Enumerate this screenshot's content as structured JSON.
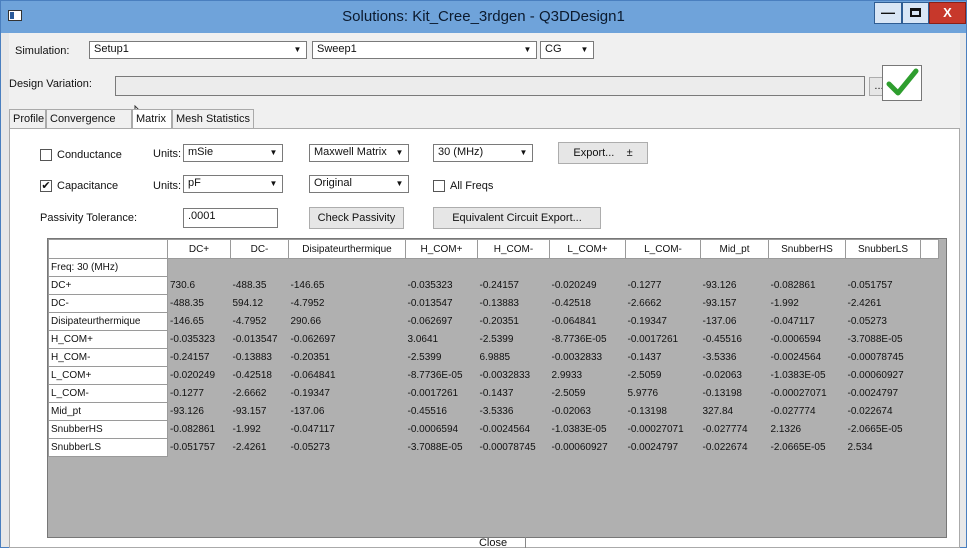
{
  "window": {
    "title": "Solutions: Kit_Cree_3rdgen - Q3DDesign1",
    "min_glyph": "—",
    "close_glyph": "X"
  },
  "simulation": {
    "label": "Simulation:",
    "setup": "Setup1",
    "sweep": "Sweep1",
    "type": "CG"
  },
  "design_variation": {
    "label": "Design Variation:",
    "value": "",
    "browse_label": "..."
  },
  "tabs": [
    "Profile",
    "Convergence",
    "Matrix",
    "Mesh Statistics"
  ],
  "matrix": {
    "conductance": {
      "label": "Conductance",
      "checked": false,
      "units_label": "Units:",
      "units": "mSie"
    },
    "capacitance": {
      "label": "Capacitance",
      "checked": true,
      "units_label": "Units:",
      "units": "pF"
    },
    "matrix_type": "Maxwell Matrix",
    "matrix_variant": "Original",
    "frequency": "30 (MHz)",
    "export_label": "Export...",
    "export_icon": "download-icon",
    "all_freqs_label": "All Freqs",
    "passivity_label": "Passivity Tolerance:",
    "passivity_value": ".0001",
    "check_passivity_label": "Check Passivity",
    "equiv_circuit_label": "Equivalent Circuit Export..."
  },
  "table": {
    "columns": [
      "DC+",
      "DC-",
      "Disipateurthermique",
      "H_COM+",
      "H_COM-",
      "L_COM+",
      "L_COM-",
      "Mid_pt",
      "SnubberHS",
      "SnubberLS"
    ],
    "freq_row": "Freq: 30 (MHz)",
    "rows": [
      {
        "name": "DC+",
        "values": [
          "730.6",
          "-488.35",
          "-146.65",
          "-0.035323",
          "-0.24157",
          "-0.020249",
          "-0.1277",
          "-93.126",
          "-0.082861",
          "-0.051757"
        ]
      },
      {
        "name": "DC-",
        "values": [
          "-488.35",
          "594.12",
          "-4.7952",
          "-0.013547",
          "-0.13883",
          "-0.42518",
          "-2.6662",
          "-93.157",
          "-1.992",
          "-2.4261"
        ]
      },
      {
        "name": "Disipateurthermique",
        "values": [
          "-146.65",
          "-4.7952",
          "290.66",
          "-0.062697",
          "-0.20351",
          "-0.064841",
          "-0.19347",
          "-137.06",
          "-0.047117",
          "-0.05273"
        ]
      },
      {
        "name": "H_COM+",
        "values": [
          "-0.035323",
          "-0.013547",
          "-0.062697",
          "3.0641",
          "-2.5399",
          "-8.7736E-05",
          "-0.0017261",
          "-0.45516",
          "-0.0006594",
          "-3.7088E-05"
        ]
      },
      {
        "name": "H_COM-",
        "values": [
          "-0.24157",
          "-0.13883",
          "-0.20351",
          "-2.5399",
          "6.9885",
          "-0.0032833",
          "-0.1437",
          "-3.5336",
          "-0.0024564",
          "-0.00078745"
        ]
      },
      {
        "name": "L_COM+",
        "values": [
          "-0.020249",
          "-0.42518",
          "-0.064841",
          "-8.7736E-05",
          "-0.0032833",
          "2.9933",
          "-2.5059",
          "-0.02063",
          "-1.0383E-05",
          "-0.00060927"
        ]
      },
      {
        "name": "L_COM-",
        "values": [
          "-0.1277",
          "-2.6662",
          "-0.19347",
          "-0.0017261",
          "-0.1437",
          "-2.5059",
          "5.9776",
          "-0.13198",
          "-0.00027071",
          "-0.0024797"
        ]
      },
      {
        "name": "Mid_pt",
        "values": [
          "-93.126",
          "-93.157",
          "-137.06",
          "-0.45516",
          "-3.5336",
          "-0.02063",
          "-0.13198",
          "327.84",
          "-0.027774",
          "-0.022674"
        ]
      },
      {
        "name": "SnubberHS",
        "values": [
          "-0.082861",
          "-1.992",
          "-0.047117",
          "-0.0006594",
          "-0.0024564",
          "-1.0383E-05",
          "-0.00027071",
          "-0.027774",
          "2.1326",
          "-2.0665E-05"
        ]
      },
      {
        "name": "SnubberLS",
        "values": [
          "-0.051757",
          "-2.4261",
          "-0.05273",
          "-3.7088E-05",
          "-0.00078745",
          "-0.00060927",
          "-0.0024797",
          "-0.022674",
          "-2.0665E-05",
          "2.534"
        ]
      }
    ]
  },
  "footer": {
    "close_label": "Close"
  },
  "colors": {
    "titlebar": "#6fa3da",
    "close_button": "#c7382b",
    "grid_background": "#b0b0b0",
    "check_green": "#2e9e2e"
  }
}
